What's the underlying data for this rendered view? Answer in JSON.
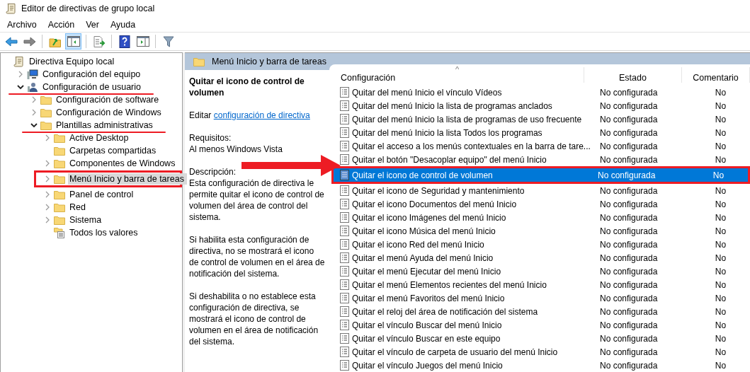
{
  "window": {
    "title": "Editor de directivas de grupo local"
  },
  "menu": [
    "Archivo",
    "Acción",
    "Ver",
    "Ayuda"
  ],
  "toolbar": [
    [
      {
        "kind": "back",
        "pressed": false
      },
      {
        "kind": "forward",
        "pressed": false
      }
    ],
    [
      {
        "kind": "up",
        "pressed": false
      },
      {
        "kind": "tree",
        "pressed": true
      }
    ],
    [
      {
        "kind": "export",
        "pressed": false
      }
    ],
    [
      {
        "kind": "help",
        "pressed": false
      },
      {
        "kind": "pane",
        "pressed": false
      }
    ],
    [
      {
        "kind": "filter",
        "pressed": false
      }
    ]
  ],
  "tree": [
    {
      "label": "Directiva Equipo local",
      "kind": "policy",
      "expandable": false,
      "selected": false,
      "children": [
        {
          "label": "Configuración del equipo",
          "kind": "computer",
          "expandable": true,
          "expanded": false,
          "selected": false
        },
        {
          "label": "Configuración de usuario",
          "kind": "user",
          "expandable": true,
          "expanded": true,
          "selected": false,
          "underlined": true,
          "children": [
            {
              "label": "Configuración de software",
              "kind": "folder",
              "expandable": true,
              "expanded": false,
              "selected": false
            },
            {
              "label": "Configuración de Windows",
              "kind": "folder",
              "expandable": true,
              "expanded": false,
              "selected": false
            },
            {
              "label": "Plantillas administrativas",
              "kind": "folder",
              "expandable": true,
              "expanded": true,
              "selected": false,
              "underlined": true,
              "children": [
                {
                  "label": "Active Desktop",
                  "kind": "folder",
                  "expandable": true,
                  "expanded": false,
                  "selected": false
                },
                {
                  "label": "Carpetas compartidas",
                  "kind": "folder",
                  "expandable": false,
                  "selected": false
                },
                {
                  "label": "Componentes de Windows",
                  "kind": "folder",
                  "expandable": true,
                  "expanded": false,
                  "selected": false
                },
                {
                  "label": "Menú Inicio y barra de tareas",
                  "kind": "folder",
                  "expandable": true,
                  "expanded": false,
                  "selected": true,
                  "framed": true
                },
                {
                  "label": "Panel de control",
                  "kind": "folder",
                  "expandable": true,
                  "expanded": false,
                  "selected": false
                },
                {
                  "label": "Red",
                  "kind": "folder",
                  "expandable": true,
                  "expanded": false,
                  "selected": false
                },
                {
                  "label": "Sistema",
                  "kind": "folder",
                  "expandable": true,
                  "expanded": false,
                  "selected": false
                },
                {
                  "label": "Todos los valores",
                  "kind": "settings",
                  "expandable": false,
                  "selected": false
                }
              ]
            }
          ]
        }
      ]
    }
  ],
  "detail": {
    "header": "Menú Inicio y barra de tareas",
    "title": "Quitar el icono de control de volumen",
    "edit_prefix": "Editar",
    "edit_link": "configuración de directiva",
    "requirements_label": "Requisitos:",
    "requirements": "Al menos Windows Vista",
    "description_label": "Descripción:",
    "paragraphs": [
      "Esta configuración de directiva le permite quitar el icono de control de volumen del área de control del sistema.",
      "Si habilita esta configuración de directiva, no se mostrará el icono de control de volumen en el área de notificación del sistema.",
      "Si deshabilita o no establece esta configuración de directiva, se mostrará el icono de control de volumen en el área de notificación del sistema."
    ]
  },
  "list": {
    "columns": [
      "Configuración",
      "Estado",
      "Comentario"
    ],
    "sort_caret": "^",
    "rows": [
      {
        "name": "Quitar del menú Inicio el vínculo Vídeos",
        "state": "No configurada",
        "comment": "No",
        "selected": false
      },
      {
        "name": "Quitar del menú Inicio la lista de programas anclados",
        "state": "No configurada",
        "comment": "No",
        "selected": false
      },
      {
        "name": "Quitar del menú Inicio la lista de programas de uso frecuente",
        "state": "No configurada",
        "comment": "No",
        "selected": false
      },
      {
        "name": "Quitar del menú Inicio la lista Todos los programas",
        "state": "No configurada",
        "comment": "No",
        "selected": false
      },
      {
        "name": "Quitar el acceso a los menús contextuales en la barra de tare...",
        "state": "No configurada",
        "comment": "No",
        "selected": false
      },
      {
        "name": "Quitar el botón \"Desacoplar equipo\" del menú Inicio",
        "state": "No configurada",
        "comment": "No",
        "selected": false
      },
      {
        "name": "Quitar el icono de control de volumen",
        "state": "No configurada",
        "comment": "No",
        "selected": true,
        "framed": true
      },
      {
        "name": "Quitar el icono de Seguridad y mantenimiento",
        "state": "No configurada",
        "comment": "No",
        "selected": false
      },
      {
        "name": "Quitar el icono Documentos del menú Inicio",
        "state": "No configurada",
        "comment": "No",
        "selected": false
      },
      {
        "name": "Quitar el icono Imágenes del menú Inicio",
        "state": "No configurada",
        "comment": "No",
        "selected": false
      },
      {
        "name": "Quitar el icono Música del menú Inicio",
        "state": "No configurada",
        "comment": "No",
        "selected": false
      },
      {
        "name": "Quitar el icono Red del menú Inicio",
        "state": "No configurada",
        "comment": "No",
        "selected": false
      },
      {
        "name": "Quitar el menú Ayuda del menú Inicio",
        "state": "No configurada",
        "comment": "No",
        "selected": false
      },
      {
        "name": "Quitar el menú Ejecutar del menú Inicio",
        "state": "No configurada",
        "comment": "No",
        "selected": false
      },
      {
        "name": "Quitar el menú Elementos recientes del menú Inicio",
        "state": "No configurada",
        "comment": "No",
        "selected": false
      },
      {
        "name": "Quitar el menú Favoritos del menú Inicio",
        "state": "No configurada",
        "comment": "No",
        "selected": false
      },
      {
        "name": "Quitar el reloj del área de notificación del sistema",
        "state": "No configurada",
        "comment": "No",
        "selected": false
      },
      {
        "name": "Quitar el vínculo Buscar del menú Inicio",
        "state": "No configurada",
        "comment": "No",
        "selected": false
      },
      {
        "name": "Quitar el vínculo Buscar en este equipo",
        "state": "No configurada",
        "comment": "No",
        "selected": false
      },
      {
        "name": "Quitar el vínculo de carpeta de usuario del menú Inicio",
        "state": "No configurada",
        "comment": "No",
        "selected": false
      },
      {
        "name": "Quitar el vínculo Juegos del menú Inicio",
        "state": "No configurada",
        "comment": "No",
        "selected": false
      }
    ]
  }
}
